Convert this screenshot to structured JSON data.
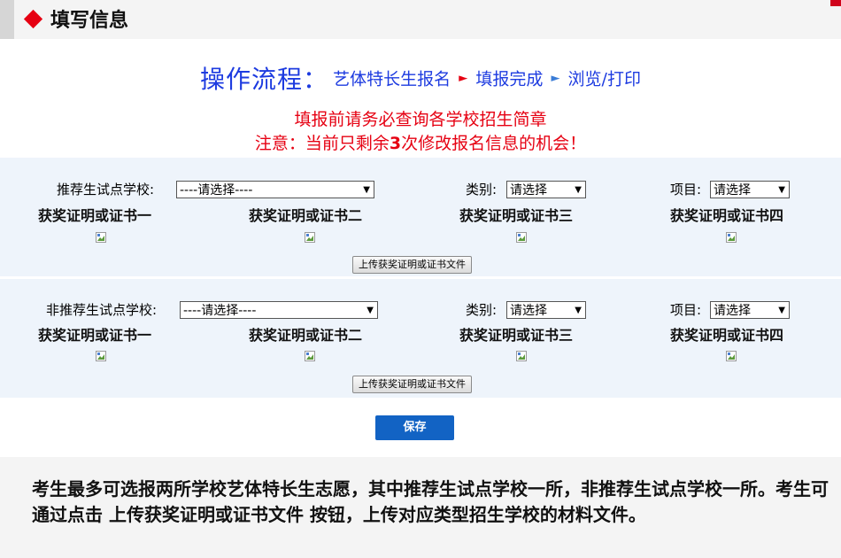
{
  "header": {
    "title": "填写信息"
  },
  "flow": {
    "title": "操作流程：",
    "steps": [
      "艺体特长生报名",
      "填报完成",
      "浏览/打印"
    ]
  },
  "notice": {
    "line1": "填报前请务必查询各学校招生简章",
    "line2_prefix": "注意：当前只剩余",
    "line2_count": "3",
    "line2_suffix": "次修改报名信息的机会！"
  },
  "recommended": {
    "school_label": "推荐生试点学校:",
    "school_select": "----请选择----",
    "category_label": "类别:",
    "category_select": "请选择",
    "item_label": "项目:",
    "item_select": "请选择",
    "certs": [
      "获奖证明或证书一",
      "获奖证明或证书二",
      "获奖证明或证书三",
      "获奖证明或证书四"
    ],
    "upload_label": "上传获奖证明或证书文件"
  },
  "non_recommended": {
    "school_label": "非推荐生试点学校:",
    "school_select": "----请选择----",
    "category_label": "类别:",
    "category_select": "请选择",
    "item_label": "项目:",
    "item_select": "请选择",
    "certs": [
      "获奖证明或证书一",
      "获奖证明或证书二",
      "获奖证明或证书三",
      "获奖证明或证书四"
    ],
    "upload_label": "上传获奖证明或证书文件"
  },
  "save_label": "保存",
  "bottom_note": "考生最多可选报两所学校艺体特长生志愿，其中推荐生试点学校一所，非推荐生试点学校一所。考生可通过点击 上传获奖证明或证书文件 按钮，上传对应类型招生学校的材料文件。",
  "colors": {
    "accent_red": "#e60012",
    "flow_blue": "#1d3be0",
    "save_blue": "#1263c4",
    "block_bg": "#eef4fb"
  }
}
